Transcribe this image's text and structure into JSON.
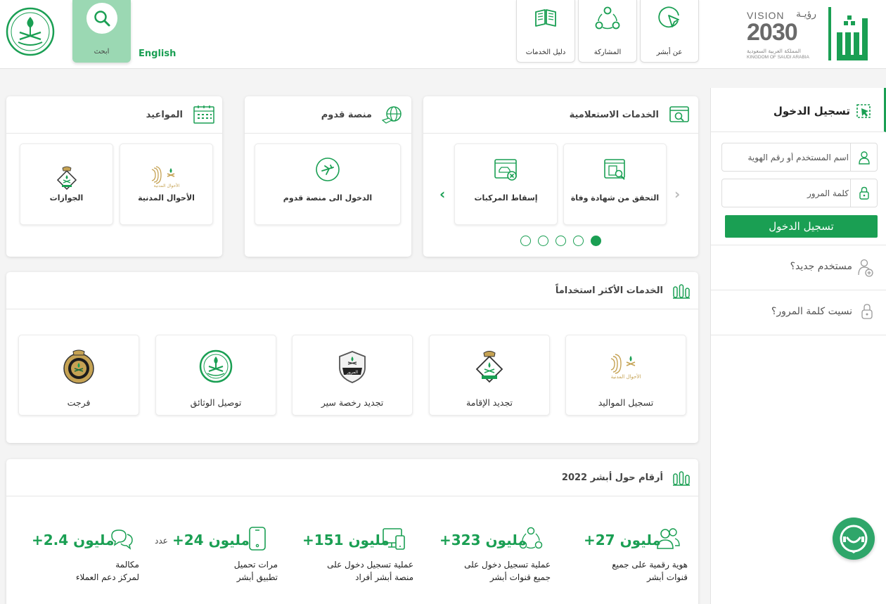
{
  "header": {
    "search_label": "ابحث",
    "language_link": "English",
    "nav": [
      {
        "label": "دليل الخدمات",
        "icon": "book-icon"
      },
      {
        "label": "المشاركة",
        "icon": "share-network-icon"
      },
      {
        "label": "عن أبشر",
        "icon": "cursor-circle-icon"
      }
    ],
    "vision": {
      "line1": "VISION",
      "line1_ar": "رؤيـة",
      "year": "2030",
      "kingdom_ar": "المملكة العربية السعودية",
      "kingdom_en": "KINGDOM OF SAUDI ARABIA"
    }
  },
  "inquiry": {
    "title": "الخدمات الاستعلامية",
    "tiles": [
      {
        "label": "التحقق من شهادة وفاة",
        "icon": "certificate-search-icon"
      },
      {
        "label": "إسقاط المركبات",
        "icon": "vehicle-removal-icon"
      }
    ],
    "dots": 5,
    "active_dot": 5
  },
  "arrival": {
    "title": "منصة قدوم",
    "tile_label": "الدخول الى منصة قدوم"
  },
  "appointments": {
    "title": "المواعيد",
    "tiles": [
      {
        "label": "الأحوال المدنية",
        "icon": "civil-affairs-logo"
      },
      {
        "label": "الجوازات",
        "icon": "passports-logo"
      }
    ]
  },
  "most_used": {
    "title": "الخدمات الأكثر استخداماً",
    "tiles": [
      {
        "label": "تسجيل المواليد",
        "icon": "civil-affairs-logo"
      },
      {
        "label": "تجديد الإقامة",
        "icon": "passports-logo"
      },
      {
        "label": "تجديد رخصة سير",
        "icon": "traffic-logo"
      },
      {
        "label": "توصيل الوثائق",
        "icon": "emblem-logo"
      },
      {
        "label": "فرجت",
        "icon": "prisons-logo"
      }
    ]
  },
  "stats": {
    "title": "أرقام حول أبشر 2022",
    "items": [
      {
        "number": "+27 مليون",
        "unit": "",
        "desc1": "هوية رقمية على جميع",
        "desc2": "قنوات أبشر",
        "icon": "users-icon"
      },
      {
        "number": "+323 مليون",
        "unit": "",
        "desc1": "عملية تسجيل دخول على",
        "desc2": "جميع قنوات أبشر",
        "icon": "network-icon"
      },
      {
        "number": "+151 مليون",
        "unit": "",
        "desc1": "عملية تسجيل دخول على",
        "desc2": "منصة أبشر أفراد",
        "icon": "devices-icon"
      },
      {
        "number": "+24 مليون",
        "unit": "عدد",
        "desc1": "مرات تحميل",
        "desc2": "تطبيق أبشر",
        "icon": "mobile-icon"
      },
      {
        "number": "+2.4 مليون",
        "unit": "",
        "desc1": "مكالمة",
        "desc2": "لمركز دعم العملاء",
        "icon": "chat-bubbles-icon"
      }
    ]
  },
  "login": {
    "title": "تسجيل الدخول",
    "username_placeholder": "اسم المستخدم أو رقم الهوية",
    "password_placeholder": "كلمة المرور",
    "button": "تسجيل الدخول",
    "new_user": "مستخدم جديد؟",
    "forgot_password": "نسيت كلمة المرور؟"
  },
  "colors": {
    "brand_green": "#1a9f53",
    "search_bg": "#9bd8b3"
  }
}
